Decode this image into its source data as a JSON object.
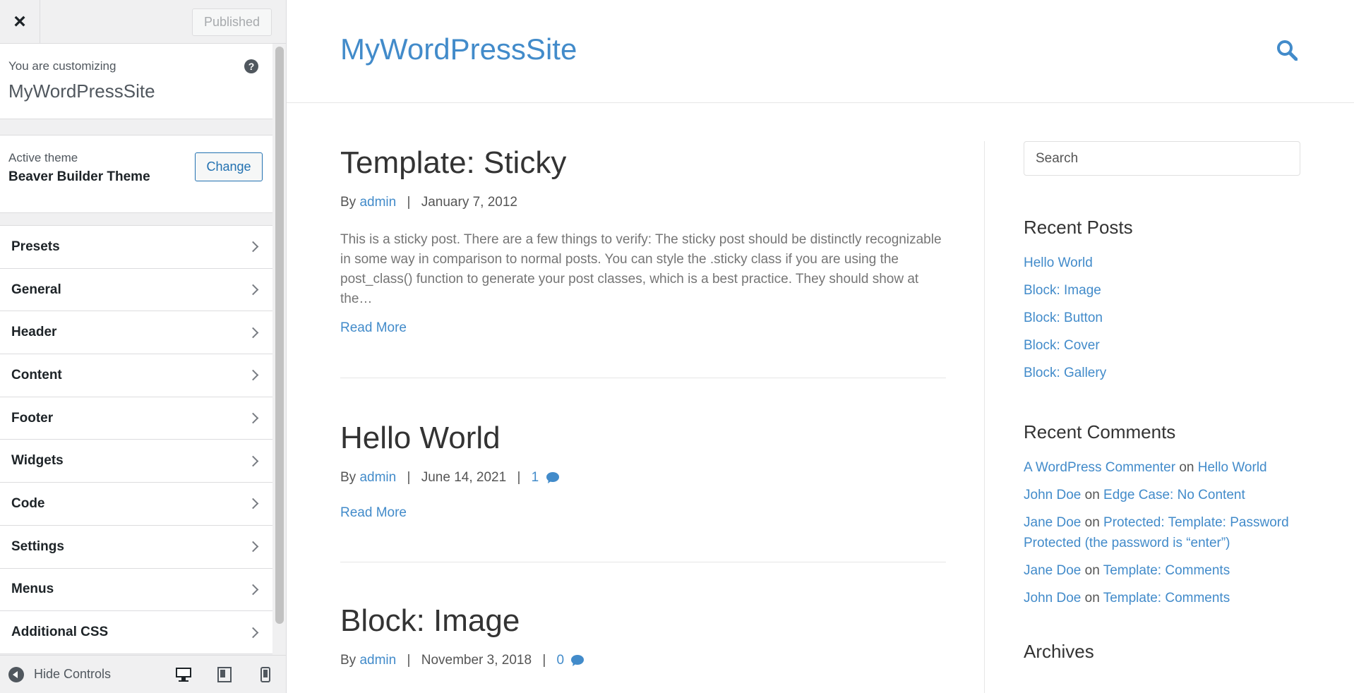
{
  "customizer": {
    "close_label": "×",
    "publish_label": "Published",
    "customizing_label": "You are customizing",
    "site_name": "MyWordPressSite",
    "help_label": "?",
    "theme": {
      "label": "Active theme",
      "name": "Beaver Builder Theme",
      "change_label": "Change"
    },
    "panels": [
      "Presets",
      "General",
      "Header",
      "Content",
      "Footer",
      "Widgets",
      "Code",
      "Settings",
      "Menus",
      "Additional CSS"
    ],
    "footer": {
      "hide_label": "Hide Controls",
      "devices": [
        "desktop",
        "tablet",
        "mobile"
      ]
    }
  },
  "site": {
    "title": "MyWordPressSite",
    "posts": [
      {
        "title": "Template: Sticky",
        "by": "By",
        "author": "admin",
        "date": "January 7, 2012",
        "excerpt": "This is a sticky post. There are a few things to verify: The sticky post should be distinctly recognizable in some way in comparison to normal posts. You can style the .sticky class if you are using the post_class() function to generate your post classes, which is a best practice. They should show at the…",
        "read_more": "Read More"
      },
      {
        "title": "Hello World",
        "by": "By",
        "author": "admin",
        "date": "June 14, 2021",
        "comments": "1",
        "read_more": "Read More"
      },
      {
        "title": "Block: Image",
        "by": "By",
        "author": "admin",
        "date": "November 3, 2018",
        "comments": "0"
      }
    ],
    "sidebar": {
      "search_placeholder": "Search",
      "recent_posts_title": "Recent Posts",
      "recent_posts": [
        "Hello World",
        "Block: Image",
        "Block: Button",
        "Block: Cover",
        "Block: Gallery"
      ],
      "recent_comments_title": "Recent Comments",
      "on_word": "on",
      "recent_comments": [
        {
          "author": "A WordPress Commenter",
          "post": "Hello World"
        },
        {
          "author": "John Doe",
          "post": "Edge Case: No Content"
        },
        {
          "author": "Jane Doe",
          "post": "Protected: Template: Password Protected (the password is “enter”)"
        },
        {
          "author": "Jane Doe",
          "post": "Template: Comments"
        },
        {
          "author": "John Doe",
          "post": "Template: Comments"
        }
      ],
      "archives_title": "Archives"
    },
    "colors": {
      "link": "#428bca",
      "button_accent": "#2271b1"
    }
  }
}
